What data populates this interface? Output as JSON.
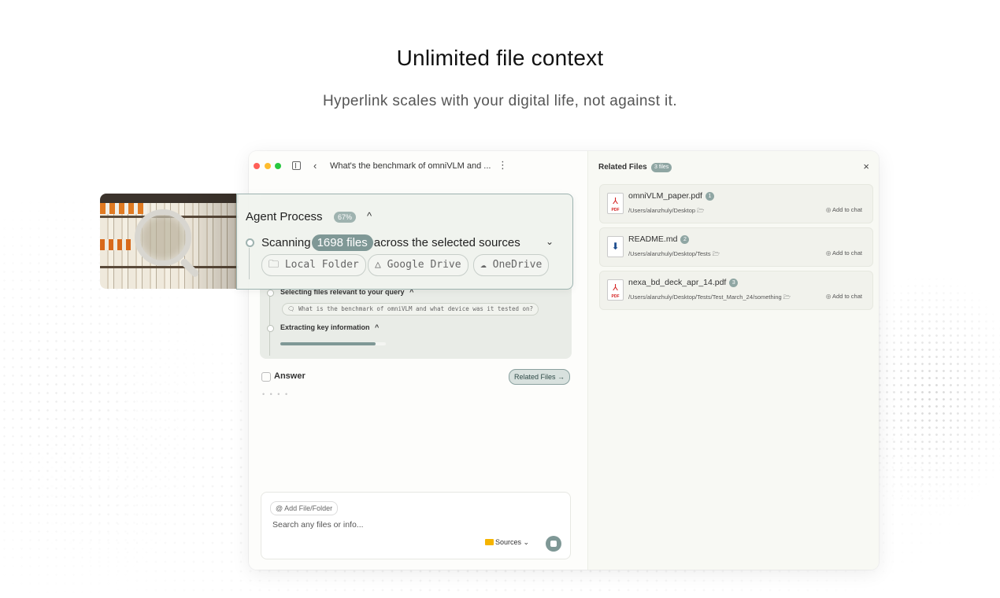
{
  "hero": {
    "title": "Unlimited file context",
    "subtitle": "Hyperlink scales with your digital life, not against it."
  },
  "window": {
    "chat_title": "What's the benchmark of omniVLM and ...",
    "back_icon": "‹",
    "more_icon": "⋮"
  },
  "agent_process": {
    "title": "Agent Process",
    "progress_label": "67%",
    "chevron": "^",
    "scan_prefix": "Scanning",
    "scan_count": "1698 files",
    "scan_suffix": "across the selected sources",
    "sources": [
      {
        "icon": "folder-icon",
        "glyph": "🗀",
        "label": "Local Folder"
      },
      {
        "icon": "google-drive-icon",
        "glyph": "△",
        "label": "Google Drive"
      },
      {
        "icon": "cloud-icon",
        "glyph": "☁",
        "label": "OneDrive"
      }
    ],
    "steps": [
      {
        "label": "Selecting files relevant to your query",
        "chevron": "^"
      },
      {
        "label": "Extracting key information",
        "chevron": "^"
      }
    ],
    "query_chip": "What is the benchmark of omniVLM and what device was it tested on?",
    "extract_progress": 0.9
  },
  "answer": {
    "label": "Answer",
    "related_button": "Related Files →",
    "typing": "• • • •"
  },
  "composer": {
    "add_chip": "@ Add File/Folder",
    "placeholder": "Search any files or info...",
    "sources_label": "Sources ⌄"
  },
  "related_files": {
    "title": "Related Files",
    "badge": "3 files",
    "close": "×",
    "add_to_chat": "◎ Add to chat",
    "files": [
      {
        "name": "omniVLM_paper.pdf",
        "num": "1",
        "path": "/Users/alanzhuly/Desktop 🗁",
        "type": "pdf"
      },
      {
        "name": "README.md",
        "num": "2",
        "path": "/Users/alanzhuly/Desktop/Tests 🗁",
        "type": "md"
      },
      {
        "name": "nexa_bd_deck_apr_14.pdf",
        "num": "3",
        "path": "/Users/alanzhuly/Desktop/Tests/Test_March_24/something 🗁",
        "type": "pdf"
      }
    ]
  },
  "colors": {
    "accent": "#7f9896",
    "close_dot": "#ff5f57",
    "minimize_dot": "#febc2e",
    "zoom_dot": "#28c840",
    "pdf_red": "#d32020"
  }
}
